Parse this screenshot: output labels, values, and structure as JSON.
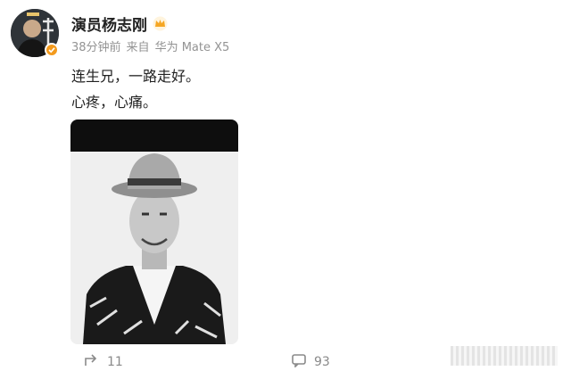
{
  "post": {
    "author": "演员杨志刚",
    "time": "38分钟前",
    "source": "来自",
    "device": "华为 Mate X5",
    "text_line1": "连生兄，一路走好。",
    "text_line2": "心疼，心痛。"
  },
  "actions": {
    "repost_count": "11",
    "comment_count": "93"
  },
  "colors": {
    "verified_badge": "#f39a1d",
    "meta_text": "#939393"
  },
  "icons": {
    "verified": "verified-icon",
    "crown": "crown-icon",
    "repost": "repost-icon",
    "comment": "comment-icon"
  }
}
